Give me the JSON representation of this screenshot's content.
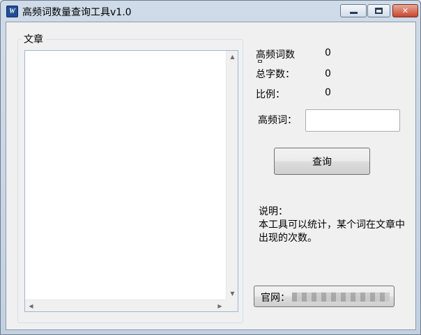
{
  "window": {
    "title": "高频词数量查询工具v1.0",
    "app_icon_letter": "W"
  },
  "titlebar_buttons": {
    "minimize": "minimize-icon",
    "maximize": "maximize-icon",
    "close_glyph": "✕"
  },
  "article": {
    "group_label": "文章",
    "text": ""
  },
  "stats": {
    "high_freq_count_label": "高频词数",
    "high_freq_count_value": "0",
    "total_chars_label": "总字数：",
    "total_chars_value": "0",
    "ratio_label": "比例：",
    "ratio_value": "0"
  },
  "query": {
    "word_label": "高频词：",
    "word_value": "",
    "button_label": "查询"
  },
  "description": {
    "title": "说明：",
    "body": "本工具可以统计，某个词在文章中出现的次数。"
  },
  "website": {
    "label": "官网："
  }
}
